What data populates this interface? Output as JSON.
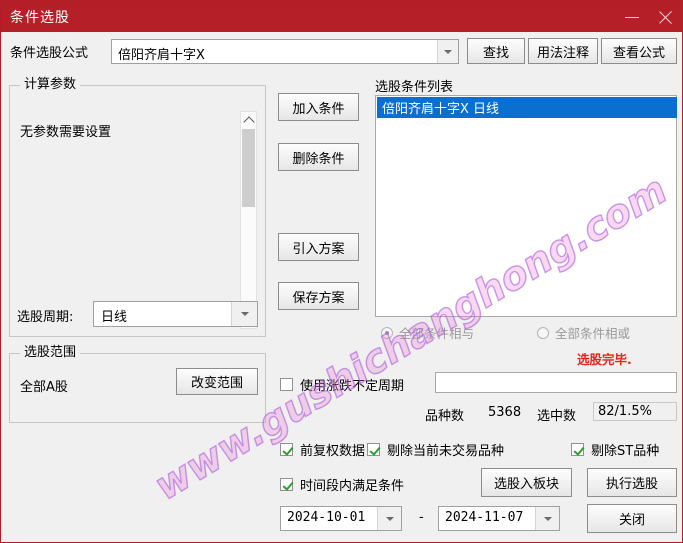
{
  "window": {
    "title": "条件选股",
    "minimize_icon": "minimize-icon",
    "close_icon": "close-icon",
    "accent_color": "#b52028"
  },
  "formula_row": {
    "label": "条件选股公式",
    "value": "倍阳齐肩十字X",
    "placeholder": "",
    "dropdown_icon": "chevron-down-icon",
    "buttons": [
      {
        "label": "查找"
      },
      {
        "label": "用法注释"
      },
      {
        "label": "查看公式"
      }
    ]
  },
  "params_group": {
    "title": "计算参数",
    "text": "无参数需要设置",
    "scroll_up_icon": "chevron-up-icon",
    "scroll_down_icon": "chevron-down-icon"
  },
  "cycle": {
    "label": "选股周期:",
    "value": "日线",
    "dropdown_icon": "chevron-down-icon"
  },
  "range_group": {
    "title": "选股范围",
    "value": "全部A股",
    "change_button": "改变范围"
  },
  "action_buttons": {
    "add": "加入条件",
    "delete": "删除条件",
    "import": "引入方案",
    "save": "保存方案"
  },
  "condition_list": {
    "title": "选股条件列表",
    "items": [
      {
        "label": "倍阳齐肩十字X  日线",
        "selected": true
      }
    ],
    "selected_bg": "#0a6fd0"
  },
  "logic_radios": [
    {
      "label": "全部条件相与",
      "selected": true
    },
    {
      "label": "全部条件相或",
      "selected": false
    }
  ],
  "status": {
    "done_text": "选股完毕.",
    "done_color": "#e8251c",
    "total_label": "品种数",
    "total_value": "5368",
    "selected_label": "选中数",
    "selected_value": "82/1.5%"
  },
  "updown_cycle": {
    "label": "使用涨跌不定周期",
    "checked": false,
    "field_value": ""
  },
  "options": [
    {
      "label": "前复权数据",
      "checked": true
    },
    {
      "label": "剔除当前未交易品种",
      "checked": true
    },
    {
      "label": "剔除ST品种",
      "checked": true
    },
    {
      "label": "时间段内满足条件",
      "checked": true
    }
  ],
  "date_range": {
    "start": "2024-10-01",
    "end": "2024-11-07",
    "separator": "-",
    "dropdown_icon": "chevron-down-icon"
  },
  "bottom_buttons": {
    "to_block": "选股入板块",
    "execute": "执行选股",
    "close": "关闭"
  },
  "watermark": {
    "text": "www.gushichanghong.com"
  }
}
